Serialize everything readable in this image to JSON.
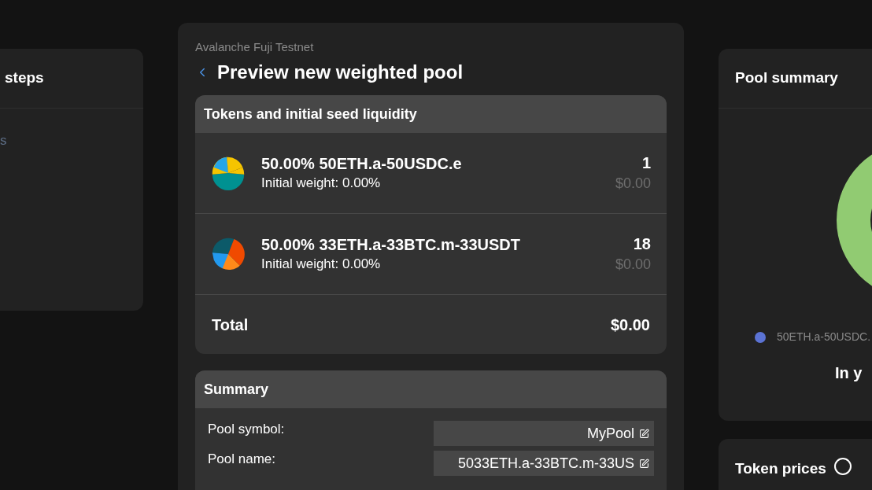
{
  "left_panel": {
    "title": "steps",
    "link": "s"
  },
  "main": {
    "network": "Avalanche Fuji Testnet",
    "title": "Preview new weighted pool",
    "tokens_card": {
      "title": "Tokens and initial seed liquidity",
      "tokens": [
        {
          "name": "50.00% 50ETH.a-50USDC.e",
          "weight": "Initial weight: 0.00%",
          "amount": "1",
          "value": "$0.00",
          "kind": "pie-a"
        },
        {
          "name": "50.00% 33ETH.a-33BTC.m-33USDT",
          "weight": "Initial weight: 0.00%",
          "amount": "18",
          "value": "$0.00",
          "kind": "pie-b"
        }
      ],
      "total_label": "Total",
      "total_value": "$0.00"
    },
    "summary_card": {
      "title": "Summary",
      "fields": [
        {
          "label": "Pool symbol:",
          "value": "MyPool"
        },
        {
          "label": "Pool name:",
          "value": "5033ETH.a-33BTC.m-33US"
        }
      ]
    }
  },
  "pool_summary": {
    "title": "Pool summary",
    "legend": [
      {
        "label": "50ETH.a-50USDC.",
        "color": "#5b73d4"
      }
    ],
    "note": "In y"
  },
  "token_prices": {
    "title": "Token prices"
  }
}
